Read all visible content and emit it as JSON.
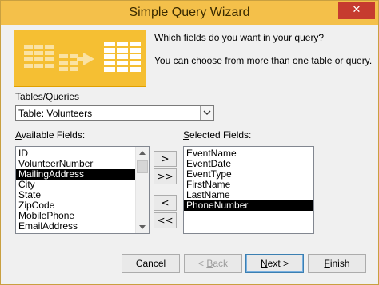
{
  "window": {
    "title": "Simple Query Wizard",
    "close_glyph": "✕"
  },
  "prompt": {
    "question": "Which fields do you want in your query?",
    "hint": "You can choose from more than one table or query."
  },
  "tables": {
    "label_u": "T",
    "label_rest": "ables/Queries",
    "selected": "Table: Volunteers"
  },
  "available": {
    "label_u": "A",
    "label_rest": "vailable Fields:",
    "items": [
      "ID",
      "VolunteerNumber",
      "MailingAddress",
      "City",
      "State",
      "ZipCode",
      "MobilePhone",
      "EmailAddress"
    ],
    "selected_item": "MailingAddress"
  },
  "selected_fields": {
    "label_u": "S",
    "label_rest": "elected Fields:",
    "items": [
      "EventName",
      "EventDate",
      "EventType",
      "FirstName",
      "LastName",
      "PhoneNumber"
    ],
    "selected_item": "PhoneNumber"
  },
  "move_buttons": {
    "add": ">",
    "add_all": ">>",
    "remove": "<",
    "remove_all": "<<"
  },
  "footer": {
    "cancel": "Cancel",
    "back_u": "B",
    "back_pre": "< ",
    "back_rest": "ack",
    "next_u": "N",
    "next_rest": "ext >",
    "finish_u": "F",
    "finish_rest": "inish"
  },
  "colors": {
    "titlebar": "#f4c04a",
    "banner": "#f5bf33",
    "selection": "#000000",
    "close_button": "#c63b2f"
  },
  "icons": [
    "close-icon",
    "wizard-banner-illustration",
    "dropdown-chevron-icon",
    "scroll-up-icon",
    "scroll-down-icon"
  ]
}
